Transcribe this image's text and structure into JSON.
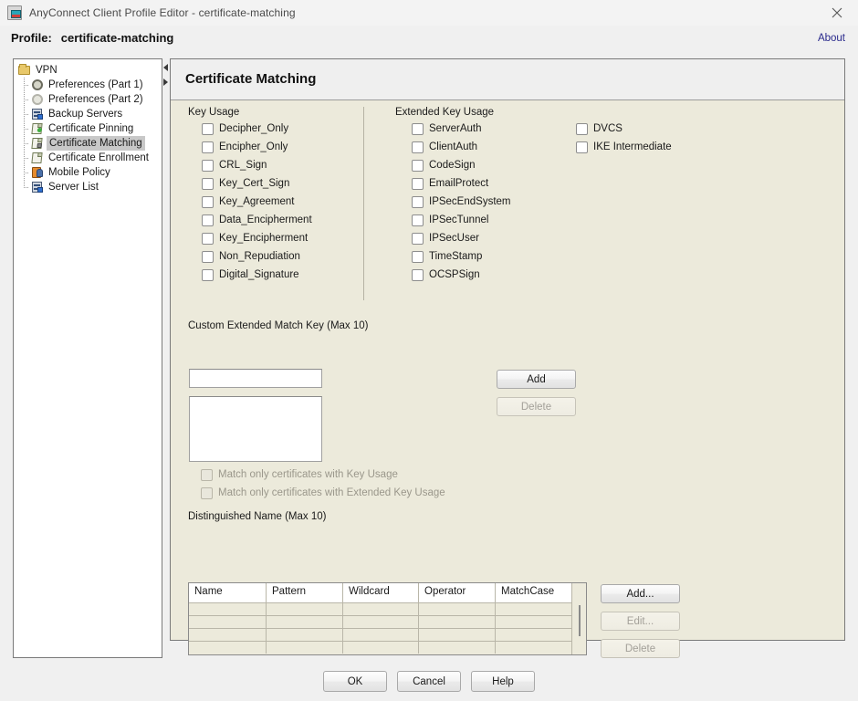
{
  "window": {
    "title": "AnyConnect Client Profile Editor - certificate-matching",
    "app_icon": "app-window-icon",
    "close_icon": "close-icon"
  },
  "profile_bar": {
    "label": "Profile:",
    "value": "certificate-matching",
    "about_label": "About"
  },
  "tree": {
    "root": {
      "label": "VPN",
      "icon": "folder-icon"
    },
    "items": [
      {
        "label": "Preferences (Part 1)",
        "icon": "gear-icon",
        "selected": false
      },
      {
        "label": "Preferences (Part 2)",
        "icon": "gear-dim-icon",
        "selected": false
      },
      {
        "label": "Backup Servers",
        "icon": "server-icon",
        "selected": false
      },
      {
        "label": "Certificate Pinning",
        "icon": "certificate-pin-icon",
        "selected": false
      },
      {
        "label": "Certificate Matching",
        "icon": "certificate-lock-icon",
        "selected": true
      },
      {
        "label": "Certificate Enrollment",
        "icon": "certificate-enroll-icon",
        "selected": false
      },
      {
        "label": "Mobile Policy",
        "icon": "mobile-policy-icon",
        "selected": false
      },
      {
        "label": "Server List",
        "icon": "server-list-icon",
        "selected": false
      }
    ]
  },
  "panel": {
    "title": "Certificate Matching",
    "key_usage": {
      "heading": "Key Usage",
      "items": [
        {
          "label": "Decipher_Only",
          "checked": false
        },
        {
          "label": "Encipher_Only",
          "checked": false
        },
        {
          "label": "CRL_Sign",
          "checked": false
        },
        {
          "label": "Key_Cert_Sign",
          "checked": false
        },
        {
          "label": "Key_Agreement",
          "checked": false
        },
        {
          "label": "Data_Encipherment",
          "checked": false
        },
        {
          "label": "Key_Encipherment",
          "checked": false
        },
        {
          "label": "Non_Repudiation",
          "checked": false
        },
        {
          "label": "Digital_Signature",
          "checked": false
        }
      ]
    },
    "extended_key_usage": {
      "heading": "Extended Key Usage",
      "items": [
        {
          "label": "ServerAuth",
          "checked": false
        },
        {
          "label": "ClientAuth",
          "checked": false
        },
        {
          "label": "CodeSign",
          "checked": false
        },
        {
          "label": "EmailProtect",
          "checked": false
        },
        {
          "label": "IPSecEndSystem",
          "checked": false
        },
        {
          "label": "IPSecTunnel",
          "checked": false
        },
        {
          "label": "IPSecUser",
          "checked": false
        },
        {
          "label": "TimeStamp",
          "checked": false
        },
        {
          "label": "OCSPSign",
          "checked": false
        }
      ],
      "items_col2": [
        {
          "label": "DVCS",
          "checked": false
        },
        {
          "label": "IKE Intermediate",
          "checked": false
        }
      ]
    },
    "custom_match": {
      "heading": "Custom Extended Match Key (Max 10)",
      "input_value": "",
      "input_placeholder": "",
      "add_label": "Add",
      "delete_label": "Delete",
      "delete_enabled": false,
      "list_items": []
    },
    "match_options": [
      {
        "label": "Match only certificates with Key Usage",
        "checked": false,
        "enabled": false
      },
      {
        "label": "Match only certificates with Extended Key Usage",
        "checked": false,
        "enabled": false
      }
    ],
    "distinguished_name": {
      "heading": "Distinguished Name (Max 10)",
      "columns": [
        "Name",
        "Pattern",
        "Wildcard",
        "Operator",
        "MatchCase"
      ],
      "rows": [
        [
          "",
          "",
          "",
          "",
          ""
        ],
        [
          "",
          "",
          "",
          "",
          ""
        ],
        [
          "",
          "",
          "",
          "",
          ""
        ],
        [
          "",
          "",
          "",
          "",
          ""
        ]
      ],
      "add_label": "Add...",
      "edit_label": "Edit...",
      "delete_label": "Delete",
      "edit_enabled": false,
      "delete_enabled": false
    }
  },
  "footer": {
    "ok_label": "OK",
    "cancel_label": "Cancel",
    "help_label": "Help"
  },
  "colors": {
    "panel_bg": "#eceadb",
    "window_bg": "#f0f0f0",
    "header_bg": "#efefef",
    "link": "#2a2a8c",
    "selection": "#c8c8c8"
  }
}
